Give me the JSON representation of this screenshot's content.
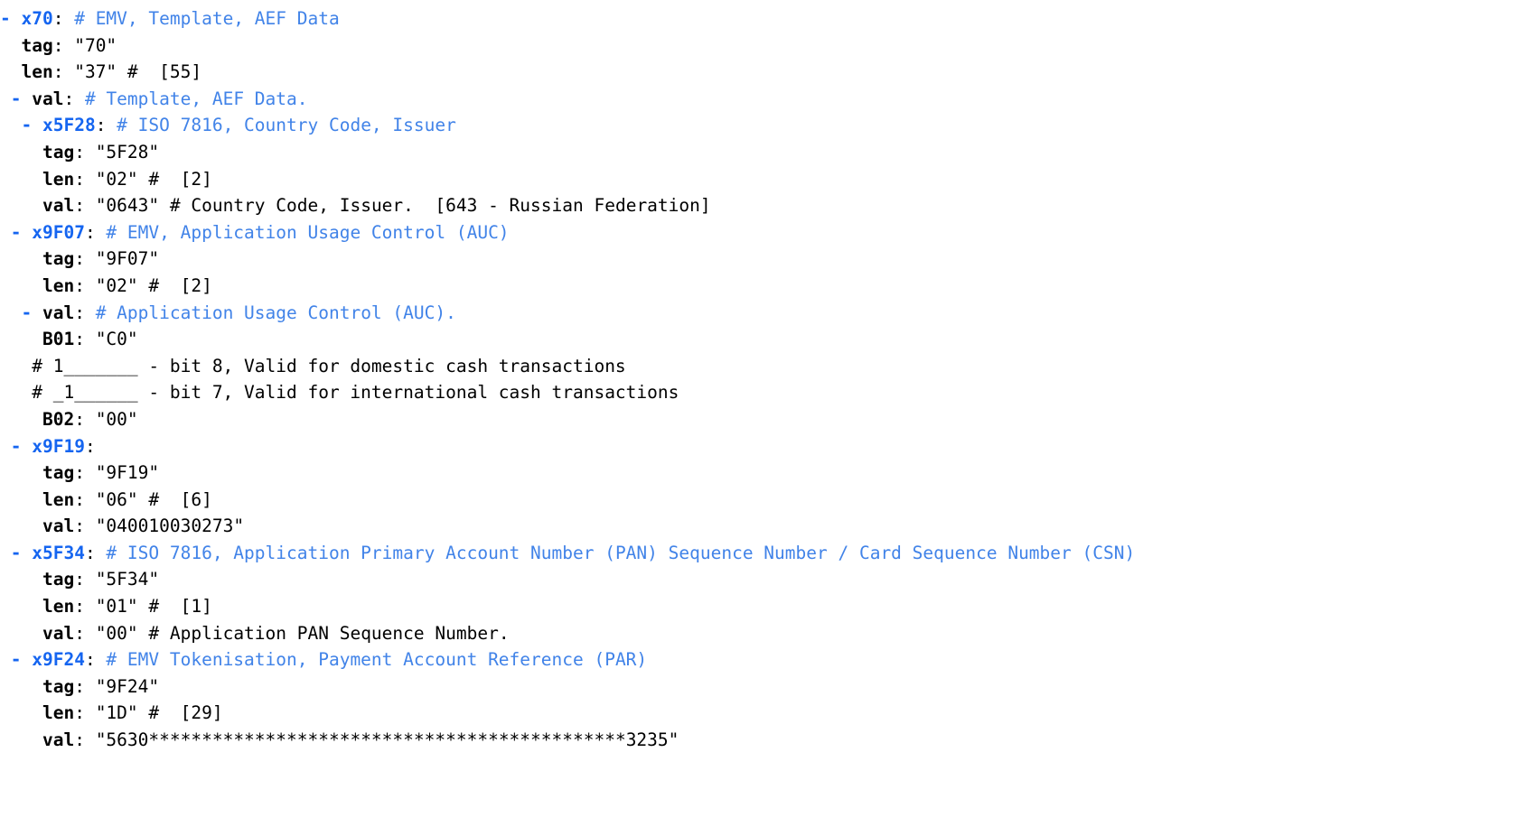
{
  "document": {
    "type": "yaml-tlv-dump",
    "title": "EMV TLV YAML dump",
    "colors": {
      "key_blue": "#1565f0",
      "comment_blue": "#4183e8",
      "text_black": "#000000",
      "background": "#ffffff"
    }
  },
  "lines": [
    {
      "indent": "",
      "dash": "- ",
      "key": "x70",
      "colon": ":",
      "value": "",
      "comment": " # EMV, Template, AEF Data",
      "comment_color": "blue"
    },
    {
      "indent": "  ",
      "dash": "",
      "key": "tag",
      "colon": ":",
      "value": " \"70\"",
      "comment": "",
      "comment_color": "blue"
    },
    {
      "indent": "  ",
      "dash": "",
      "key": "len",
      "colon": ":",
      "value": " \"37\"",
      "comment": " #  [55]",
      "comment_color": "black"
    },
    {
      "indent": "",
      "dash": " - ",
      "key": "val",
      "colon": ":",
      "value": "",
      "comment": " # Template, AEF Data.",
      "comment_color": "blue"
    },
    {
      "indent": " ",
      "dash": " - ",
      "key": "x5F28",
      "colon": ":",
      "value": "",
      "comment": " # ISO 7816, Country Code, Issuer",
      "comment_color": "blue"
    },
    {
      "indent": "    ",
      "dash": "",
      "key": "tag",
      "colon": ":",
      "value": " \"5F28\"",
      "comment": "",
      "comment_color": "blue"
    },
    {
      "indent": "    ",
      "dash": "",
      "key": "len",
      "colon": ":",
      "value": " \"02\"",
      "comment": " #  [2]",
      "comment_color": "black"
    },
    {
      "indent": "    ",
      "dash": "",
      "key": "val",
      "colon": ":",
      "value": " \"0643\"",
      "comment": " # Country Code, Issuer.  [643 - Russian Federation]",
      "comment_color": "black"
    },
    {
      "indent": " ",
      "dash": "- ",
      "key": "x9F07",
      "colon": ":",
      "value": "",
      "comment": " # EMV, Application Usage Control (AUC)",
      "comment_color": "blue"
    },
    {
      "indent": "    ",
      "dash": "",
      "key": "tag",
      "colon": ":",
      "value": " \"9F07\"",
      "comment": "",
      "comment_color": "blue"
    },
    {
      "indent": "    ",
      "dash": "",
      "key": "len",
      "colon": ":",
      "value": " \"02\"",
      "comment": " #  [2]",
      "comment_color": "black"
    },
    {
      "indent": "  ",
      "dash": "- ",
      "key": "val",
      "colon": ":",
      "value": "",
      "comment": " # Application Usage Control (AUC).",
      "comment_color": "blue"
    },
    {
      "indent": "    ",
      "dash": "",
      "key": "B01",
      "colon": ":",
      "value": " \"C0\"",
      "comment": "",
      "comment_color": "black"
    },
    {
      "indent": "   ",
      "dash": "",
      "key": "",
      "colon": "",
      "value": "",
      "comment": "# 1_______ - bit 8, Valid for domestic cash transactions",
      "comment_color": "black"
    },
    {
      "indent": "   ",
      "dash": "",
      "key": "",
      "colon": "",
      "value": "",
      "comment": "# _1______ - bit 7, Valid for international cash transactions",
      "comment_color": "black"
    },
    {
      "indent": "    ",
      "dash": "",
      "key": "B02",
      "colon": ":",
      "value": " \"00\"",
      "comment": "",
      "comment_color": "black"
    },
    {
      "indent": " ",
      "dash": "- ",
      "key": "x9F19",
      "colon": ":",
      "value": "",
      "comment": "",
      "comment_color": "blue"
    },
    {
      "indent": "    ",
      "dash": "",
      "key": "tag",
      "colon": ":",
      "value": " \"9F19\"",
      "comment": "",
      "comment_color": "blue"
    },
    {
      "indent": "    ",
      "dash": "",
      "key": "len",
      "colon": ":",
      "value": " \"06\"",
      "comment": " #  [6]",
      "comment_color": "black"
    },
    {
      "indent": "    ",
      "dash": "",
      "key": "val",
      "colon": ":",
      "value": " \"040010030273\"",
      "comment": "",
      "comment_color": "black"
    },
    {
      "indent": " ",
      "dash": "- ",
      "key": "x5F34",
      "colon": ":",
      "value": "",
      "comment": " # ISO 7816, Application Primary Account Number (PAN) Sequence Number / Card Sequence Number (CSN)",
      "comment_color": "blue"
    },
    {
      "indent": "    ",
      "dash": "",
      "key": "tag",
      "colon": ":",
      "value": " \"5F34\"",
      "comment": "",
      "comment_color": "blue"
    },
    {
      "indent": "    ",
      "dash": "",
      "key": "len",
      "colon": ":",
      "value": " \"01\"",
      "comment": " #  [1]",
      "comment_color": "black"
    },
    {
      "indent": "    ",
      "dash": "",
      "key": "val",
      "colon": ":",
      "value": " \"00\"",
      "comment": " # Application PAN Sequence Number.",
      "comment_color": "black"
    },
    {
      "indent": " ",
      "dash": "- ",
      "key": "x9F24",
      "colon": ":",
      "value": "",
      "comment": " # EMV Tokenisation, Payment Account Reference (PAR)",
      "comment_color": "blue"
    },
    {
      "indent": "    ",
      "dash": "",
      "key": "tag",
      "colon": ":",
      "value": " \"9F24\"",
      "comment": "",
      "comment_color": "blue"
    },
    {
      "indent": "    ",
      "dash": "",
      "key": "len",
      "colon": ":",
      "value": " \"1D\"",
      "comment": " #  [29]",
      "comment_color": "black"
    },
    {
      "indent": "    ",
      "dash": "",
      "key": "val",
      "colon": ":",
      "value": " \"5630*********************************************3235\"",
      "comment": "",
      "comment_color": "black"
    }
  ]
}
